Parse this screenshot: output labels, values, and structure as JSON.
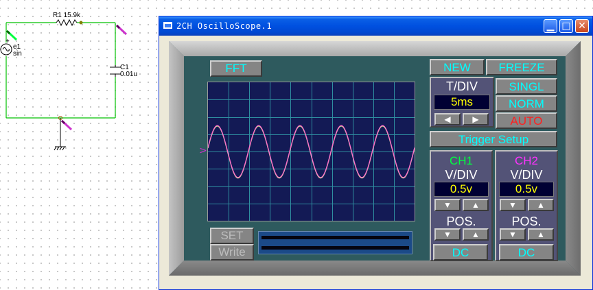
{
  "schematic": {
    "resistor_label": "R1 15.9k",
    "source_label_name": "e1",
    "source_label_type": "sin",
    "source_plus": "+",
    "capacitor_label_name": "C1",
    "capacitor_label_value": "0.01u"
  },
  "window": {
    "title": "2CH OscilloScope.1",
    "minimize_label": "▁",
    "maximize_label": "□",
    "close_label": "✕"
  },
  "scope": {
    "fft_label": "FFT",
    "new_label": "NEW",
    "freeze_label": "FREEZE",
    "tdiv_label": "T/DIV",
    "tdiv_value": "5ms",
    "singl_label": "SINGL",
    "norm_label": "NORM",
    "auto_label": "AUTO",
    "trigger_setup_label": "Trigger Setup",
    "set_label": "SET",
    "write_label": "Write",
    "trigger_marker": ">",
    "left_arrow": "◀",
    "right_arrow": "▶",
    "down_arrow": "▼",
    "up_arrow": "▲",
    "ch1": {
      "name": "CH1",
      "vdiv_label": "V/DIV",
      "vdiv_value": "0.5v",
      "pos_label": "POS.",
      "coupling": "DC",
      "color": "#00ff40"
    },
    "ch2": {
      "name": "CH2",
      "vdiv_label": "V/DIV",
      "vdiv_value": "0.5v",
      "pos_label": "POS.",
      "coupling": "DC",
      "color": "#ff33ff"
    },
    "trace": {
      "cycles_on_screen": 5,
      "amplitude_divisions": 1.5,
      "ch1_color": "#ff66cc",
      "ch2_color": "#c8ff8a"
    }
  },
  "colors": {
    "wire": "#00c000",
    "probe_ch1": "#00ff40",
    "probe_ch2": "#cc33cc",
    "screen_bg": "#131a55",
    "grid": "#2f8fa0"
  }
}
